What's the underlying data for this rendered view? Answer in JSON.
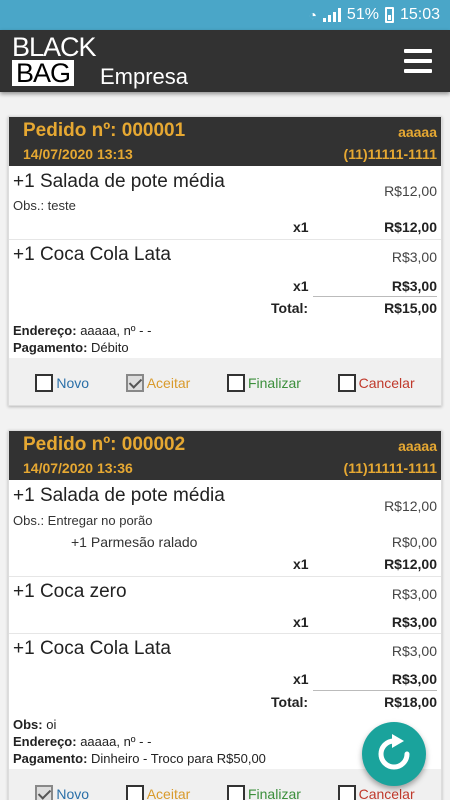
{
  "status": {
    "battery": "51%",
    "time": "15:03"
  },
  "app": {
    "logo_line1": "BLACK",
    "logo_line2": "BAG",
    "subtitle": "Empresa"
  },
  "orders": [
    {
      "number": "Pedido nº: 000001",
      "datetime": "14/07/2020 13:13",
      "customer": "aaaaa",
      "phone": "(11)11111-1111",
      "items": [
        {
          "name": "+1 Salada de pote média",
          "price": "R$12,00",
          "obs": "Obs.: teste",
          "qty": "x1",
          "subtotal": "R$12,00"
        },
        {
          "name": "+1 Coca Cola Lata",
          "price": "R$3,00",
          "qty": "x1",
          "subtotal": "R$3,00"
        }
      ],
      "total_label": "Total:",
      "total": "R$15,00",
      "address_label": "Endereço:",
      "address": "aaaaa, nº - -",
      "payment_label": "Pagamento:",
      "payment": "Débito",
      "actions": {
        "novo": "Novo",
        "aceitar": "Aceitar",
        "finalizar": "Finalizar",
        "cancelar": "Cancelar"
      }
    },
    {
      "number": "Pedido nº: 000002",
      "datetime": "14/07/2020 13:36",
      "customer": "aaaaa",
      "phone": "(11)11111-1111",
      "items": [
        {
          "name": "+1 Salada de pote média",
          "price": "R$12,00",
          "obs": "Obs.: Entregar no porão",
          "addon": "+1 Parmesão ralado",
          "addon_price": "R$0,00",
          "qty": "x1",
          "subtotal": "R$12,00"
        },
        {
          "name": "+1 Coca zero",
          "price": "R$3,00",
          "qty": "x1",
          "subtotal": "R$3,00"
        },
        {
          "name": "+1 Coca Cola Lata",
          "price": "R$3,00",
          "qty": "x1",
          "subtotal": "R$3,00"
        }
      ],
      "total_label": "Total:",
      "total": "R$18,00",
      "obs_label": "Obs:",
      "obs": "oi",
      "address_label": "Endereço:",
      "address": "aaaaa, nº - -",
      "payment_label": "Pagamento:",
      "payment": "Dinheiro - Troco para R$50,00",
      "actions": {
        "novo": "Novo",
        "aceitar": "Aceitar",
        "finalizar": "Finalizar",
        "cancelar": "Cancelar"
      }
    }
  ],
  "colors": {
    "statusbar": "#4aa6c8",
    "appbar": "#323232",
    "order_header_text": "#e6a832",
    "fab": "#1aa39c"
  },
  "icons": {
    "menu": "hamburger-icon",
    "refresh": "refresh-icon"
  }
}
